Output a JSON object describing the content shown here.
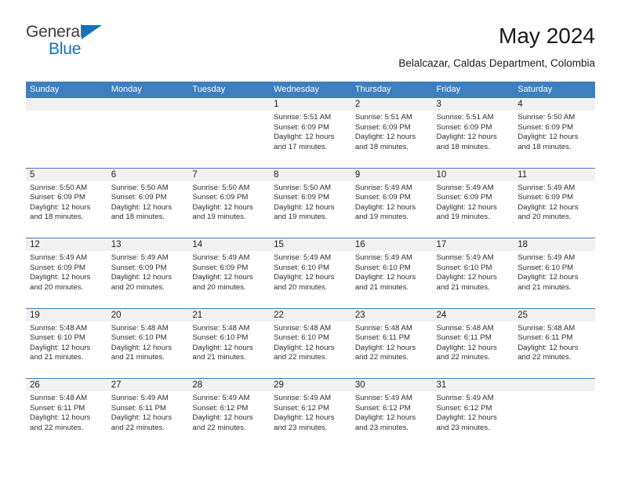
{
  "brand": {
    "name_part1": "General",
    "name_part2": "Blue",
    "triangle_icon": "blue-triangle-logo-mark",
    "colors": {
      "dark": "#3b3b3b",
      "blue": "#1272bc"
    }
  },
  "header": {
    "title": "May 2024",
    "subtitle": "Belalcazar, Caldas Department, Colombia"
  },
  "calendar": {
    "accent_color": "#3d7fbf",
    "band_color": "#f1f1f1",
    "weekdays": [
      "Sunday",
      "Monday",
      "Tuesday",
      "Wednesday",
      "Thursday",
      "Friday",
      "Saturday"
    ],
    "weeks": [
      [
        {
          "day": "",
          "empty": true
        },
        {
          "day": "",
          "empty": true
        },
        {
          "day": "",
          "empty": true
        },
        {
          "day": "1",
          "sunrise": "Sunrise: 5:51 AM",
          "sunset": "Sunset: 6:09 PM",
          "daylight_line1": "Daylight: 12 hours",
          "daylight_line2": "and 17 minutes."
        },
        {
          "day": "2",
          "sunrise": "Sunrise: 5:51 AM",
          "sunset": "Sunset: 6:09 PM",
          "daylight_line1": "Daylight: 12 hours",
          "daylight_line2": "and 18 minutes."
        },
        {
          "day": "3",
          "sunrise": "Sunrise: 5:51 AM",
          "sunset": "Sunset: 6:09 PM",
          "daylight_line1": "Daylight: 12 hours",
          "daylight_line2": "and 18 minutes."
        },
        {
          "day": "4",
          "sunrise": "Sunrise: 5:50 AM",
          "sunset": "Sunset: 6:09 PM",
          "daylight_line1": "Daylight: 12 hours",
          "daylight_line2": "and 18 minutes."
        }
      ],
      [
        {
          "day": "5",
          "sunrise": "Sunrise: 5:50 AM",
          "sunset": "Sunset: 6:09 PM",
          "daylight_line1": "Daylight: 12 hours",
          "daylight_line2": "and 18 minutes."
        },
        {
          "day": "6",
          "sunrise": "Sunrise: 5:50 AM",
          "sunset": "Sunset: 6:09 PM",
          "daylight_line1": "Daylight: 12 hours",
          "daylight_line2": "and 18 minutes."
        },
        {
          "day": "7",
          "sunrise": "Sunrise: 5:50 AM",
          "sunset": "Sunset: 6:09 PM",
          "daylight_line1": "Daylight: 12 hours",
          "daylight_line2": "and 19 minutes."
        },
        {
          "day": "8",
          "sunrise": "Sunrise: 5:50 AM",
          "sunset": "Sunset: 6:09 PM",
          "daylight_line1": "Daylight: 12 hours",
          "daylight_line2": "and 19 minutes."
        },
        {
          "day": "9",
          "sunrise": "Sunrise: 5:49 AM",
          "sunset": "Sunset: 6:09 PM",
          "daylight_line1": "Daylight: 12 hours",
          "daylight_line2": "and 19 minutes."
        },
        {
          "day": "10",
          "sunrise": "Sunrise: 5:49 AM",
          "sunset": "Sunset: 6:09 PM",
          "daylight_line1": "Daylight: 12 hours",
          "daylight_line2": "and 19 minutes."
        },
        {
          "day": "11",
          "sunrise": "Sunrise: 5:49 AM",
          "sunset": "Sunset: 6:09 PM",
          "daylight_line1": "Daylight: 12 hours",
          "daylight_line2": "and 20 minutes."
        }
      ],
      [
        {
          "day": "12",
          "sunrise": "Sunrise: 5:49 AM",
          "sunset": "Sunset: 6:09 PM",
          "daylight_line1": "Daylight: 12 hours",
          "daylight_line2": "and 20 minutes."
        },
        {
          "day": "13",
          "sunrise": "Sunrise: 5:49 AM",
          "sunset": "Sunset: 6:09 PM",
          "daylight_line1": "Daylight: 12 hours",
          "daylight_line2": "and 20 minutes."
        },
        {
          "day": "14",
          "sunrise": "Sunrise: 5:49 AM",
          "sunset": "Sunset: 6:09 PM",
          "daylight_line1": "Daylight: 12 hours",
          "daylight_line2": "and 20 minutes."
        },
        {
          "day": "15",
          "sunrise": "Sunrise: 5:49 AM",
          "sunset": "Sunset: 6:10 PM",
          "daylight_line1": "Daylight: 12 hours",
          "daylight_line2": "and 20 minutes."
        },
        {
          "day": "16",
          "sunrise": "Sunrise: 5:49 AM",
          "sunset": "Sunset: 6:10 PM",
          "daylight_line1": "Daylight: 12 hours",
          "daylight_line2": "and 21 minutes."
        },
        {
          "day": "17",
          "sunrise": "Sunrise: 5:49 AM",
          "sunset": "Sunset: 6:10 PM",
          "daylight_line1": "Daylight: 12 hours",
          "daylight_line2": "and 21 minutes."
        },
        {
          "day": "18",
          "sunrise": "Sunrise: 5:49 AM",
          "sunset": "Sunset: 6:10 PM",
          "daylight_line1": "Daylight: 12 hours",
          "daylight_line2": "and 21 minutes."
        }
      ],
      [
        {
          "day": "19",
          "sunrise": "Sunrise: 5:48 AM",
          "sunset": "Sunset: 6:10 PM",
          "daylight_line1": "Daylight: 12 hours",
          "daylight_line2": "and 21 minutes."
        },
        {
          "day": "20",
          "sunrise": "Sunrise: 5:48 AM",
          "sunset": "Sunset: 6:10 PM",
          "daylight_line1": "Daylight: 12 hours",
          "daylight_line2": "and 21 minutes."
        },
        {
          "day": "21",
          "sunrise": "Sunrise: 5:48 AM",
          "sunset": "Sunset: 6:10 PM",
          "daylight_line1": "Daylight: 12 hours",
          "daylight_line2": "and 21 minutes."
        },
        {
          "day": "22",
          "sunrise": "Sunrise: 5:48 AM",
          "sunset": "Sunset: 6:10 PM",
          "daylight_line1": "Daylight: 12 hours",
          "daylight_line2": "and 22 minutes."
        },
        {
          "day": "23",
          "sunrise": "Sunrise: 5:48 AM",
          "sunset": "Sunset: 6:11 PM",
          "daylight_line1": "Daylight: 12 hours",
          "daylight_line2": "and 22 minutes."
        },
        {
          "day": "24",
          "sunrise": "Sunrise: 5:48 AM",
          "sunset": "Sunset: 6:11 PM",
          "daylight_line1": "Daylight: 12 hours",
          "daylight_line2": "and 22 minutes."
        },
        {
          "day": "25",
          "sunrise": "Sunrise: 5:48 AM",
          "sunset": "Sunset: 6:11 PM",
          "daylight_line1": "Daylight: 12 hours",
          "daylight_line2": "and 22 minutes."
        }
      ],
      [
        {
          "day": "26",
          "sunrise": "Sunrise: 5:48 AM",
          "sunset": "Sunset: 6:11 PM",
          "daylight_line1": "Daylight: 12 hours",
          "daylight_line2": "and 22 minutes."
        },
        {
          "day": "27",
          "sunrise": "Sunrise: 5:49 AM",
          "sunset": "Sunset: 6:11 PM",
          "daylight_line1": "Daylight: 12 hours",
          "daylight_line2": "and 22 minutes."
        },
        {
          "day": "28",
          "sunrise": "Sunrise: 5:49 AM",
          "sunset": "Sunset: 6:12 PM",
          "daylight_line1": "Daylight: 12 hours",
          "daylight_line2": "and 22 minutes."
        },
        {
          "day": "29",
          "sunrise": "Sunrise: 5:49 AM",
          "sunset": "Sunset: 6:12 PM",
          "daylight_line1": "Daylight: 12 hours",
          "daylight_line2": "and 23 minutes."
        },
        {
          "day": "30",
          "sunrise": "Sunrise: 5:49 AM",
          "sunset": "Sunset: 6:12 PM",
          "daylight_line1": "Daylight: 12 hours",
          "daylight_line2": "and 23 minutes."
        },
        {
          "day": "31",
          "sunrise": "Sunrise: 5:49 AM",
          "sunset": "Sunset: 6:12 PM",
          "daylight_line1": "Daylight: 12 hours",
          "daylight_line2": "and 23 minutes."
        },
        {
          "day": "",
          "empty": true
        }
      ]
    ]
  }
}
